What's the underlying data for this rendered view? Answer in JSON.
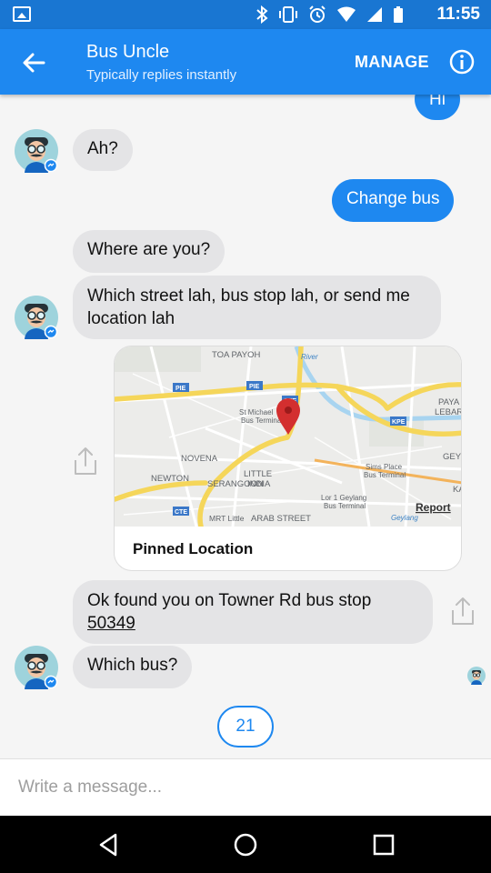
{
  "status_bar": {
    "time": "11:55",
    "icons": [
      "image-icon",
      "bluetooth-icon",
      "vibrate-icon",
      "alarm-icon",
      "wifi-icon",
      "signal-icon",
      "battery-icon"
    ]
  },
  "header": {
    "title": "Bus Uncle",
    "subtitle": "Typically replies instantly",
    "manage_label": "MANAGE",
    "accent_color": "#1e88f0"
  },
  "messages": {
    "hi": "Hi",
    "ah": "Ah?",
    "change_bus": "Change bus",
    "where": "Where are you?",
    "which_street": "Which street lah, bus stop lah, or send me location lah",
    "found_prefix": "Ok found you on Towner Rd bus stop",
    "found_stop": "50349",
    "which_bus": "Which bus?"
  },
  "map_card": {
    "caption": "Pinned Location",
    "report": "Report",
    "labels": {
      "toa_payoh": "TOA PAYOH",
      "kallang_river": "River",
      "pie1": "PIE",
      "pie2": "PIE",
      "cte": "CTE",
      "kpe": "KPE",
      "st_michael": "St Michael",
      "bus_term": "Bus Terminal",
      "novena": "NOVENA",
      "serangoon": "SERANGOON",
      "newton": "NEWTON",
      "little_india": "LITTLE",
      "little_india2": "INDIA",
      "sims_place": "Sims Place",
      "sims_bus": "Bus Terminal",
      "lor1": "Lor 1 Geylang",
      "lor1_bus": "Bus Terminal",
      "paya": "PAYA",
      "lebar": "LEBAR",
      "gey": "GEY",
      "ka": "KA",
      "cte2": "CTE",
      "mrt": "MRT Little",
      "arab": "ARAB STREET",
      "geylang": "Geylang"
    }
  },
  "quick_reply": "21",
  "composer": {
    "placeholder": "Write a message..."
  },
  "colors": {
    "incoming_bubble": "#e4e4e6",
    "outgoing_bubble": "#1e88f0",
    "map_pin": "#d32f2f"
  }
}
